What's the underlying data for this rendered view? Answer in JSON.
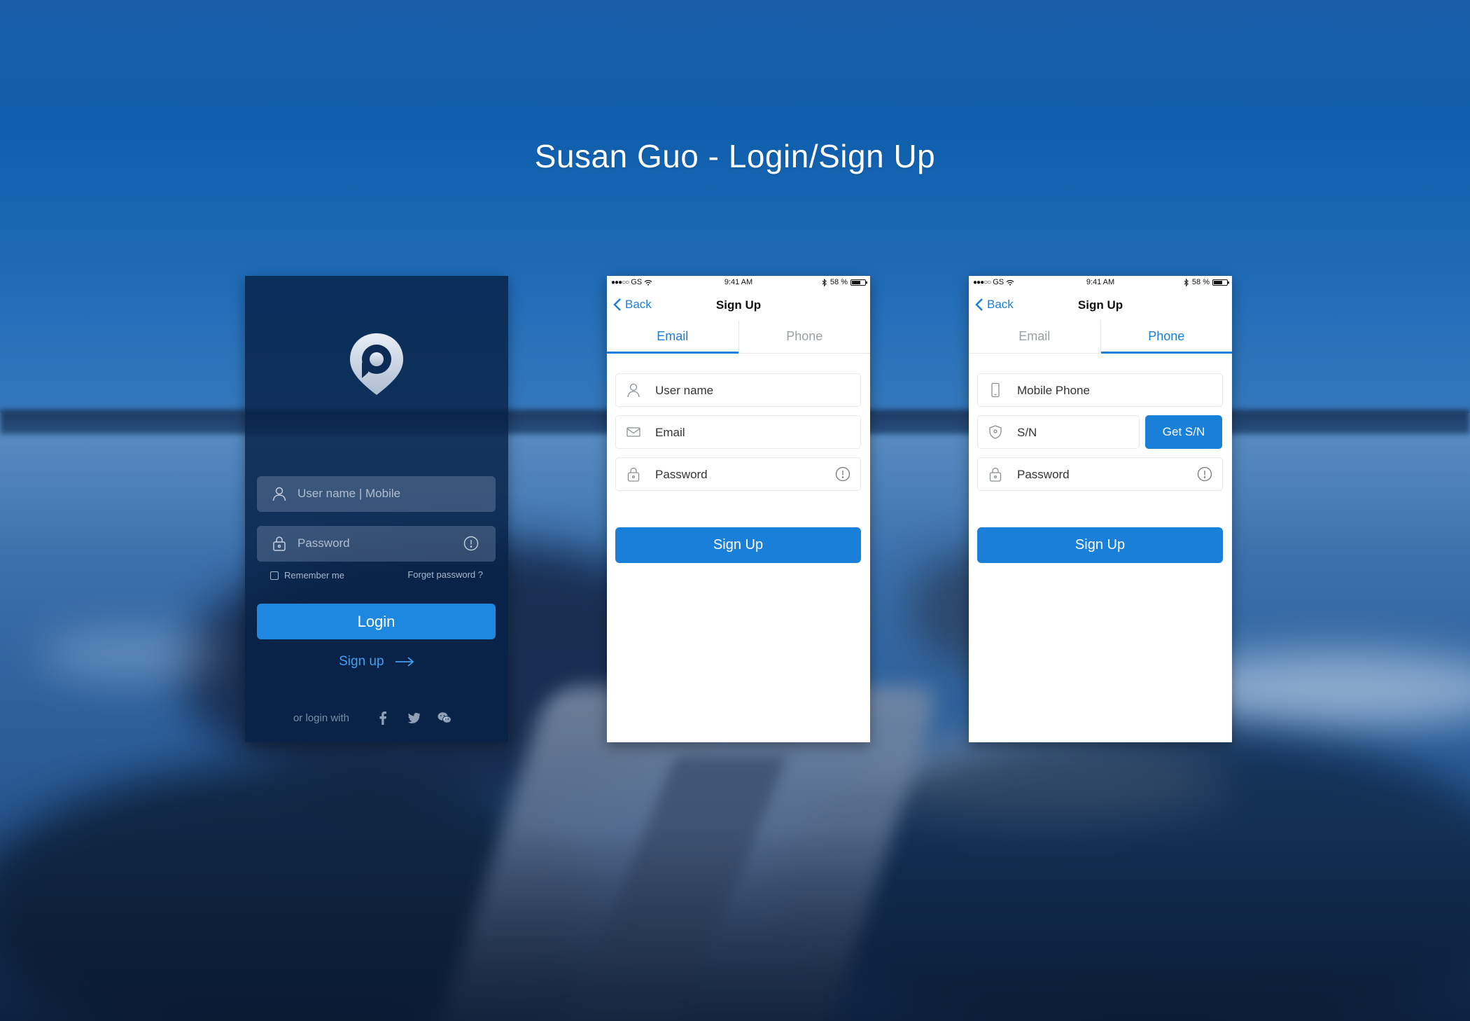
{
  "page": {
    "title": "Susan Guo - Login/Sign Up"
  },
  "colors": {
    "accent": "#1a7fd8",
    "dark_panel": "#062146"
  },
  "login": {
    "username_placeholder": "User name | Mobile",
    "password_placeholder": "Password",
    "remember_label": "Remember me",
    "forget_label": "Forget password ?",
    "login_label": "Login",
    "signup_label": "Sign up",
    "social_label": "or login with",
    "social_icons": [
      "facebook-icon",
      "twitter-icon",
      "wechat-icon"
    ]
  },
  "status_bar": {
    "carrier": "GS",
    "time": "9:41 AM",
    "battery": "58 %"
  },
  "email_signup": {
    "back_label": "Back",
    "nav_title": "Sign Up",
    "tabs": [
      {
        "label": "Email"
      },
      {
        "label": "Phone"
      }
    ],
    "active_tab": "Email",
    "username_placeholder": "User name",
    "email_placeholder": "Email",
    "password_placeholder": "Password",
    "signup_label": "Sign Up"
  },
  "phone_signup": {
    "back_label": "Back",
    "nav_title": "Sign Up",
    "tabs": [
      {
        "label": "Email"
      },
      {
        "label": "Phone"
      }
    ],
    "active_tab": "Phone",
    "mobile_placeholder": "Mobile Phone",
    "sn_placeholder": "S/N",
    "get_sn_label": "Get S/N",
    "password_placeholder": "Password",
    "signup_label": "Sign Up"
  }
}
